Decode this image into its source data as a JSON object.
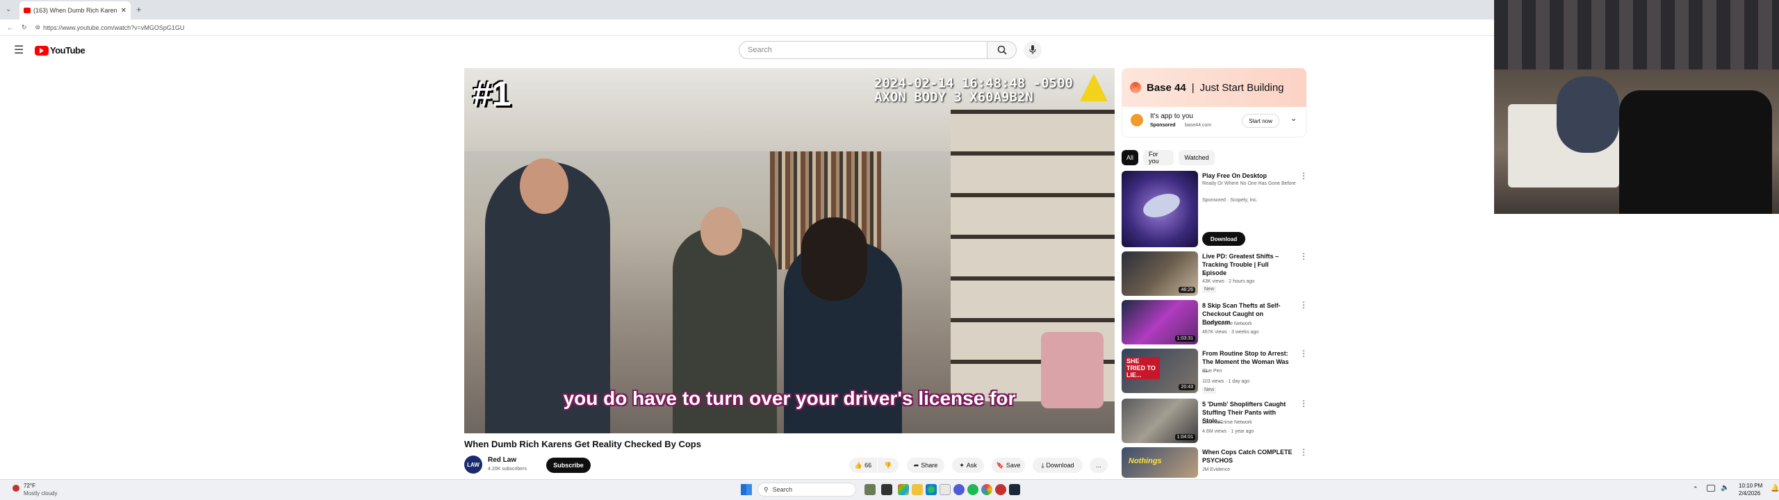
{
  "browser": {
    "tab_title": "(163) When Dumb Rich Karen",
    "url": "https://www.youtube.com/watch?v=vMGOSpG1GU"
  },
  "header": {
    "logo_text": "YouTube",
    "search_placeholder": "Search"
  },
  "video": {
    "overlay_rank": "#1",
    "timestamp_line1": "2024-02-14 16:48:48 -0500",
    "timestamp_line2": "AXON BODY 3 X60A9B2N",
    "caption": "you do have to turn over your driver's license for",
    "title": "When Dumb Rich Karens Get Reality Checked By Cops",
    "channel_name": "Red Law",
    "channel_avatar_text": "LAW",
    "channel_subs": "4.20K subscribers",
    "subscribe_label": "Subscribe",
    "likes": "66",
    "share_label": "Share",
    "ask_label": "Ask",
    "save_label": "Save",
    "download_label": "Download",
    "more_label": "..."
  },
  "ad": {
    "brand": "Base 44",
    "separator": "|",
    "tagline": "Just Start Building",
    "text": "It's app to you",
    "sponsored": "Sponsored",
    "domain": "base44.com",
    "cta": "Start now"
  },
  "chips": [
    "All",
    "For you",
    "Watched"
  ],
  "recommendations": [
    {
      "title": "Play Free On Desktop",
      "line2": "Ready Or Where No One Has Gone Before",
      "meta1": "Sponsored · Scopely, Inc.",
      "meta2": "",
      "action": "Download",
      "duration": ""
    },
    {
      "title": "Live PD: Greatest Shifts – Tracking Trouble | Full Episode",
      "line2": "",
      "meta1": "A&E",
      "meta2": "43K views · 2 hours ago",
      "badge": "New",
      "duration": "46:26"
    },
    {
      "title": "8 Skip Scan Thefts at Self-Checkout Caught on Bodycam",
      "line2": "",
      "meta1": "LawAndCrime Network",
      "meta2": "467K views · 3 weeks ago",
      "duration": "1:03:31"
    },
    {
      "title": "From Routine Stop to Arrest: The Moment the Woman Was ...",
      "line2": "",
      "meta1": "Blue Pen",
      "meta2": "103 views · 1 day ago",
      "badge": "New",
      "duration": "20:43",
      "thumb_text": "SHE TRIED TO LIE..."
    },
    {
      "title": "5 'Dumb' Shoplifters Caught Stuffing Their Pants with Stole...",
      "line2": "",
      "meta1": "LawAndCrime Network",
      "meta2": "4.6M views · 1 year ago",
      "duration": "1:04:01"
    },
    {
      "title": "When Cops Catch COMPLETE PSYCHOS",
      "line2": "",
      "meta1": "JM Evidence",
      "meta2": "",
      "duration": "",
      "thumb_text": "Nothings"
    }
  ],
  "taskbar": {
    "weather_temp": "72°F",
    "weather_desc": "Mostly cloudy",
    "search_label": "Search",
    "time": "10:10 PM",
    "date": "2/4/2026"
  },
  "colors": {
    "yt_red": "#ff0000",
    "accent_blue": "#065fd4"
  }
}
